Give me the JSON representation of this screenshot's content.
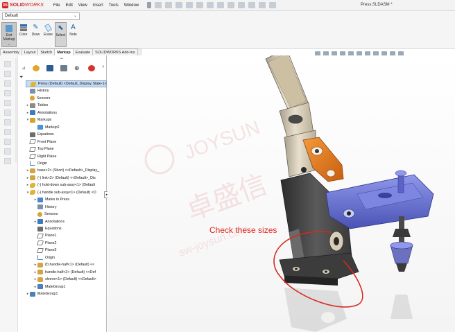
{
  "app": {
    "brand_prefix": "3S",
    "brand_bold": "SOLID",
    "brand_italic": "WORKS",
    "document_title": "Press.SLDASM *"
  },
  "menu": [
    "File",
    "Edit",
    "View",
    "Insert",
    "Tools",
    "Window"
  ],
  "command_manager": {
    "configuration": "Default",
    "tools": [
      {
        "name": "exit-markup",
        "label": "Exit Markup",
        "icon": "exit-markup-icon"
      },
      {
        "name": "color",
        "label": "Color",
        "icon": "color-icon"
      },
      {
        "name": "draw",
        "label": "Draw",
        "icon": "draw-icon"
      },
      {
        "name": "erase",
        "label": "Erase",
        "icon": "erase-icon"
      },
      {
        "name": "select",
        "label": "Select",
        "icon": "select-icon"
      },
      {
        "name": "note",
        "label": "Note",
        "icon": "note-icon"
      }
    ]
  },
  "tabs": [
    "Assembly",
    "Layout",
    "Sketch",
    "Markup",
    "Evaluate",
    "SOLIDWORKS Add-Ins"
  ],
  "active_tab": "Markup",
  "feature_tree": [
    {
      "label": "Press (Default) <Default_Display State-1>",
      "level": 0,
      "icon": "press",
      "expander": "",
      "selected": true
    },
    {
      "label": "History",
      "level": 1,
      "icon": "folder",
      "expander": ""
    },
    {
      "label": "Sensors",
      "level": 1,
      "icon": "sensor",
      "expander": ""
    },
    {
      "label": "Tables",
      "level": 1,
      "icon": "table",
      "expander": "▸"
    },
    {
      "label": "Annotations",
      "level": 1,
      "icon": "annot",
      "expander": "▸"
    },
    {
      "label": "Markups",
      "level": 1,
      "icon": "markup",
      "expander": "▾"
    },
    {
      "label": "Markup2",
      "level": 2,
      "icon": "markup2",
      "expander": ""
    },
    {
      "label": "Equations",
      "level": 1,
      "icon": "eq",
      "expander": ""
    },
    {
      "label": "Front Plane",
      "level": 1,
      "icon": "plane",
      "expander": ""
    },
    {
      "label": "Top Plane",
      "level": 1,
      "icon": "plane",
      "expander": ""
    },
    {
      "label": "Right Plane",
      "level": 1,
      "icon": "plane",
      "expander": ""
    },
    {
      "label": "Origin",
      "level": 1,
      "icon": "origin",
      "expander": ""
    },
    {
      "label": "base<2> (Short) <<Default>_Display_",
      "level": 1,
      "icon": "part",
      "expander": "▸"
    },
    {
      "label": "(-) link<2> (Default) <<Default>_Dis",
      "level": 1,
      "icon": "part",
      "expander": "▸"
    },
    {
      "label": "(-) hold-down sub-assy<1> (Default",
      "level": 1,
      "icon": "asm",
      "expander": "▸"
    },
    {
      "label": "(-) handle sub-assy<1> (Default) <D",
      "level": 1,
      "icon": "asm",
      "expander": "▾"
    },
    {
      "label": "Mates in Press",
      "level": 2,
      "icon": "mates",
      "expander": "▸"
    },
    {
      "label": "History",
      "level": 2,
      "icon": "folder",
      "expander": ""
    },
    {
      "label": "Sensors",
      "level": 2,
      "icon": "sensor",
      "expander": ""
    },
    {
      "label": "Annotations",
      "level": 2,
      "icon": "annot",
      "expander": "▸"
    },
    {
      "label": "Equations",
      "level": 2,
      "icon": "eq",
      "expander": ""
    },
    {
      "label": "Plane1",
      "level": 2,
      "icon": "plane",
      "expander": ""
    },
    {
      "label": "Plane2",
      "level": 2,
      "icon": "plane",
      "expander": ""
    },
    {
      "label": "Plane3",
      "level": 2,
      "icon": "plane",
      "expander": ""
    },
    {
      "label": "Origin",
      "level": 2,
      "icon": "origin",
      "expander": ""
    },
    {
      "label": "(f) handle-half<1> (Default) <<",
      "level": 2,
      "icon": "part",
      "expander": "▸"
    },
    {
      "label": "handle-half<2> (Default) <<Def",
      "level": 2,
      "icon": "part",
      "expander": "▸"
    },
    {
      "label": "sleeve<1> (Default) <<Default>",
      "level": 2,
      "icon": "part",
      "expander": "▸"
    },
    {
      "label": "MateGroup1",
      "level": 2,
      "icon": "mate",
      "expander": "▸"
    },
    {
      "label": "MateGroup1",
      "level": 1,
      "icon": "mate",
      "expander": "▸"
    }
  ],
  "markup": {
    "annotation_text": "Check these sizes",
    "stroke_color": "#d42a1f"
  },
  "watermark": {
    "line1": "JOYSUN",
    "line2": "卓盛信",
    "line3": "sw-joysun.com",
    "color": "#e8a0a0"
  },
  "colors": {
    "accent": "#d02020",
    "selection": "#c7dcf0",
    "part_orange": "#e47a1a",
    "part_blue": "#6e78d8",
    "part_dark": "#3a3a3a",
    "part_beige": "#d9cdb6"
  }
}
